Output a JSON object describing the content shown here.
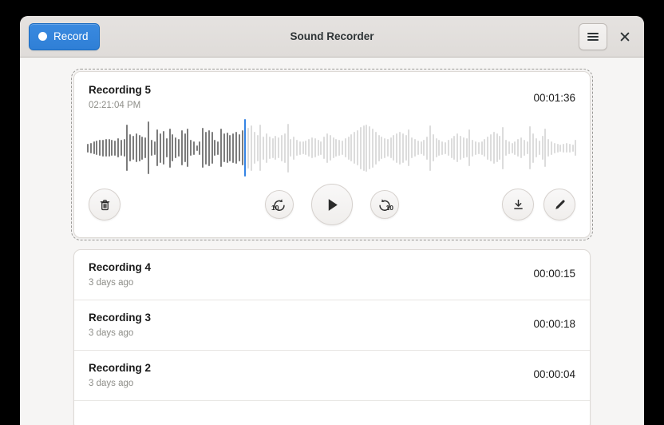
{
  "window": {
    "title": "Sound Recorder",
    "record_label": "Record",
    "record_icon": "record-dot-icon",
    "menu_icon": "hamburger-menu-icon",
    "close_icon": "close-icon",
    "accent_color": "#3584e4",
    "background_color": "#f6f5f4"
  },
  "active_recording": {
    "name": "Recording 5",
    "subtitle": "02:21:04 PM",
    "duration": "00:01:36",
    "controls": {
      "delete_icon": "trash-icon",
      "seek_back_label": "10",
      "seek_back_icon": "seek-backward-10-icon",
      "play_icon": "play-icon",
      "seek_forward_label": "10",
      "seek_forward_icon": "seek-forward-10-icon",
      "export_icon": "download-icon",
      "rename_icon": "pencil-icon"
    },
    "waveform": {
      "played_color": "#7c7c7c",
      "unplayed_color": "#dcdcdc",
      "cursor_color": "#3584e4",
      "cursor_index": 52,
      "amplitudes": [
        0.16,
        0.2,
        0.24,
        0.27,
        0.3,
        0.32,
        0.34,
        0.33,
        0.31,
        0.29,
        0.36,
        0.3,
        0.33,
        0.88,
        0.52,
        0.46,
        0.54,
        0.5,
        0.44,
        0.4,
        1.0,
        0.3,
        0.26,
        0.7,
        0.56,
        0.64,
        0.36,
        0.74,
        0.52,
        0.4,
        0.34,
        0.66,
        0.54,
        0.72,
        0.3,
        0.26,
        0.1,
        0.26,
        0.76,
        0.62,
        0.68,
        0.6,
        0.3,
        0.26,
        0.72,
        0.54,
        0.58,
        0.5,
        0.56,
        0.6,
        0.52,
        0.66,
        0.96,
        0.78,
        0.86,
        0.6,
        0.5,
        0.88,
        0.44,
        0.56,
        0.42,
        0.38,
        0.46,
        0.4,
        0.5,
        0.56,
        0.92,
        0.34,
        0.44,
        0.3,
        0.26,
        0.24,
        0.28,
        0.34,
        0.4,
        0.36,
        0.3,
        0.26,
        0.42,
        0.56,
        0.48,
        0.4,
        0.34,
        0.3,
        0.28,
        0.36,
        0.44,
        0.52,
        0.6,
        0.66,
        0.8,
        0.86,
        0.9,
        0.82,
        0.74,
        0.62,
        0.5,
        0.42,
        0.38,
        0.34,
        0.4,
        0.48,
        0.56,
        0.62,
        0.56,
        0.48,
        0.7,
        0.4,
        0.34,
        0.28,
        0.24,
        0.3,
        0.44,
        0.86,
        0.52,
        0.36,
        0.3,
        0.26,
        0.22,
        0.3,
        0.38,
        0.46,
        0.54,
        0.46,
        0.4,
        0.36,
        0.7,
        0.32,
        0.26,
        0.22,
        0.26,
        0.34,
        0.44,
        0.52,
        0.6,
        0.54,
        0.46,
        0.8,
        0.3,
        0.24,
        0.2,
        0.26,
        0.34,
        0.4,
        0.3,
        0.24,
        0.82,
        0.56,
        0.36,
        0.28,
        0.46,
        0.72,
        0.34,
        0.26,
        0.2,
        0.16,
        0.14,
        0.16,
        0.18,
        0.16,
        0.14,
        0.3
      ]
    }
  },
  "recordings": [
    {
      "name": "Recording 4",
      "subtitle": "3 days ago",
      "duration": "00:00:15"
    },
    {
      "name": "Recording 3",
      "subtitle": "3 days ago",
      "duration": "00:00:18"
    },
    {
      "name": "Recording 2",
      "subtitle": "3 days ago",
      "duration": "00:00:04"
    },
    {
      "name": "",
      "subtitle": "",
      "duration": ""
    }
  ]
}
